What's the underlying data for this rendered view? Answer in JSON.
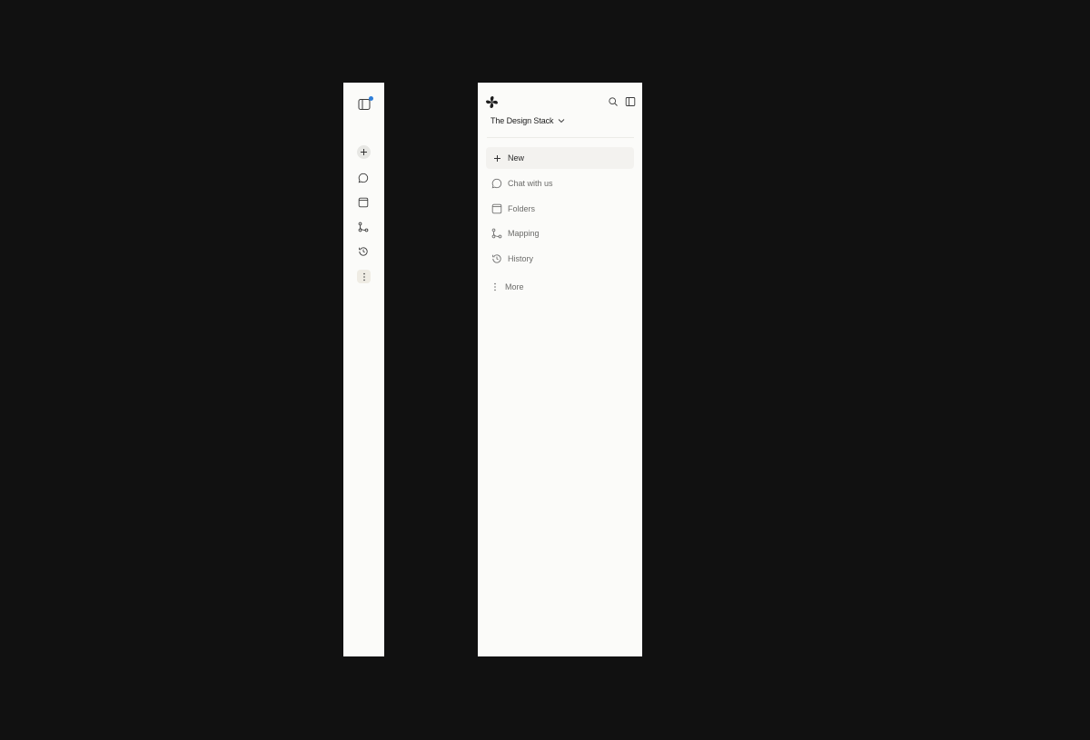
{
  "rail": {
    "items": [
      {
        "name": "new-icon"
      },
      {
        "name": "chat-icon"
      },
      {
        "name": "folder-icon"
      },
      {
        "name": "mapping-icon"
      },
      {
        "name": "history-icon"
      },
      {
        "name": "more-icon"
      }
    ],
    "notification_color": "#2f7fd9"
  },
  "sidebar": {
    "workspace_name": "The Design Stack",
    "nav": {
      "new_label": "New",
      "chat_label": "Chat with us",
      "folders_label": "Folders",
      "mapping_label": "Mapping",
      "history_label": "History",
      "more_label": "More"
    }
  },
  "colors": {
    "background": "#111111",
    "panel": "#fbfbf9",
    "active_item": "#f3f2ef",
    "text_primary": "#1c1c1c",
    "text_muted": "#6b6b69",
    "accent_dot": "#2f7fd9"
  }
}
